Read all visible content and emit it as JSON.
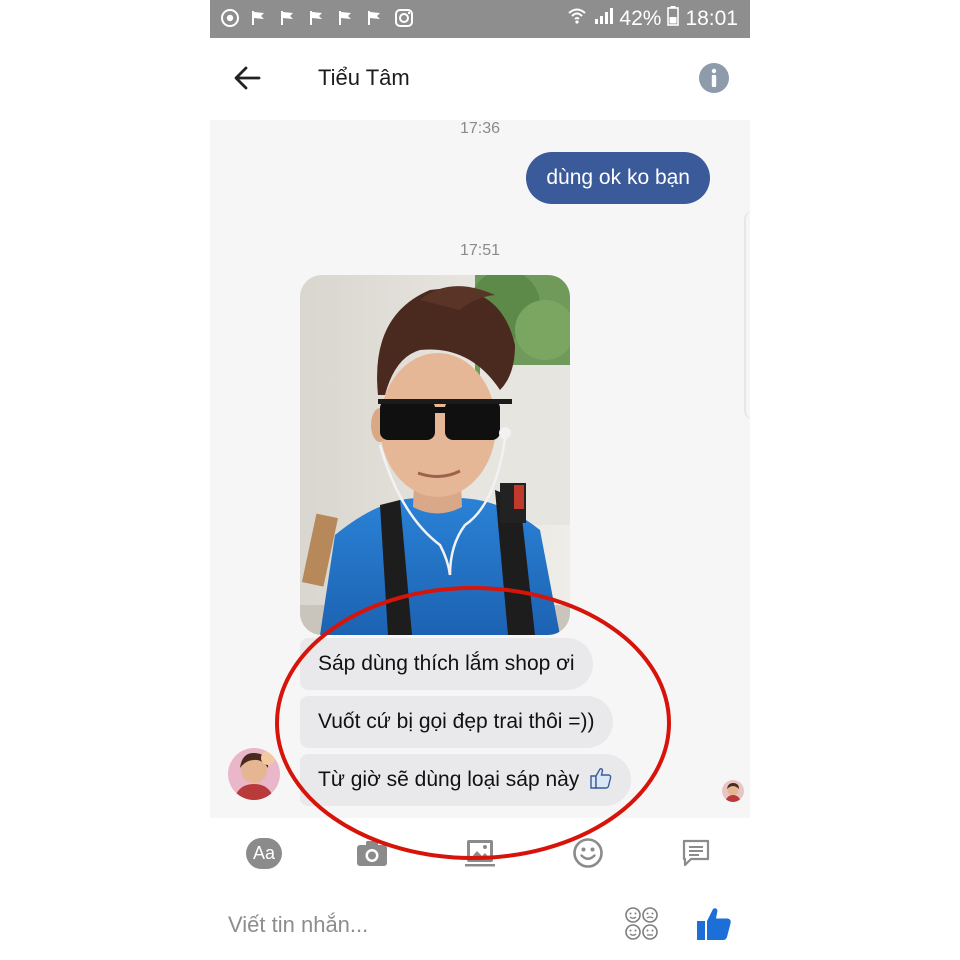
{
  "status_bar": {
    "battery": "42%",
    "time": "18:01",
    "notification_icons": [
      "chrome-icon",
      "flag-icon",
      "flag-icon",
      "flag-icon",
      "flag-icon",
      "flag-icon",
      "instagram-icon"
    ],
    "background": "#8e8e8e"
  },
  "header": {
    "title": "Tiểu Tâm",
    "back_icon": "arrow-left-icon",
    "info_icon": "info-icon"
  },
  "messages": {
    "timestamp_1": "17:36",
    "outgoing_1": "dùng ok ko bạn",
    "timestamp_2": "17:51",
    "incoming_1": "Sáp dùng thích lắm shop ơi",
    "incoming_2": "Vuốt cứ bị gọi đẹp trai thôi =))",
    "incoming_3": "Từ giờ sẽ dùng loại sáp này"
  },
  "colors": {
    "outgoing_bubble": "#3b5a9a",
    "incoming_bubble": "#e9e9eb",
    "like_blue": "#1b6fd6",
    "annotation_red": "#d7140a"
  },
  "toolbar": {
    "text_button": "Aa",
    "icons": [
      "camera-icon",
      "gallery-icon",
      "emoji-icon",
      "chat-icon"
    ]
  },
  "composer": {
    "placeholder": "Viết tin nhắn...",
    "sticker_icon": "stickers-icon",
    "like_icon": "thumbs-up-icon"
  }
}
